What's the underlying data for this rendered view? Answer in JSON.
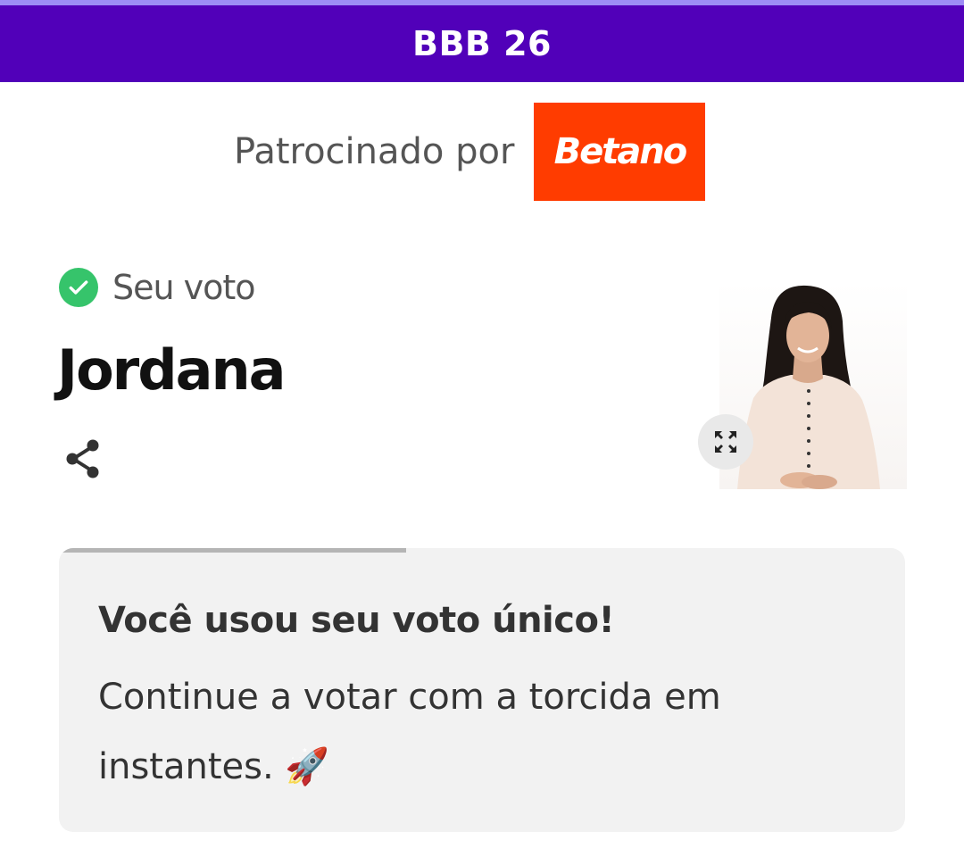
{
  "header": {
    "title": "BBB 26"
  },
  "sponsor": {
    "label": "Patrocinado por",
    "logo_text": "Betano",
    "logo_color": "#ff3c00"
  },
  "vote": {
    "status_label": "Seu voto",
    "status_icon": "check-circle-icon",
    "candidate_name": "Jordana"
  },
  "card": {
    "title": "Você usou seu voto único!",
    "message": "Continue a votar com a torcida em instantes. 🚀",
    "progress": 0.41
  },
  "colors": {
    "header_bg": "#5100b9",
    "check_green": "#36c46b",
    "card_bg": "#f2f2f2"
  }
}
